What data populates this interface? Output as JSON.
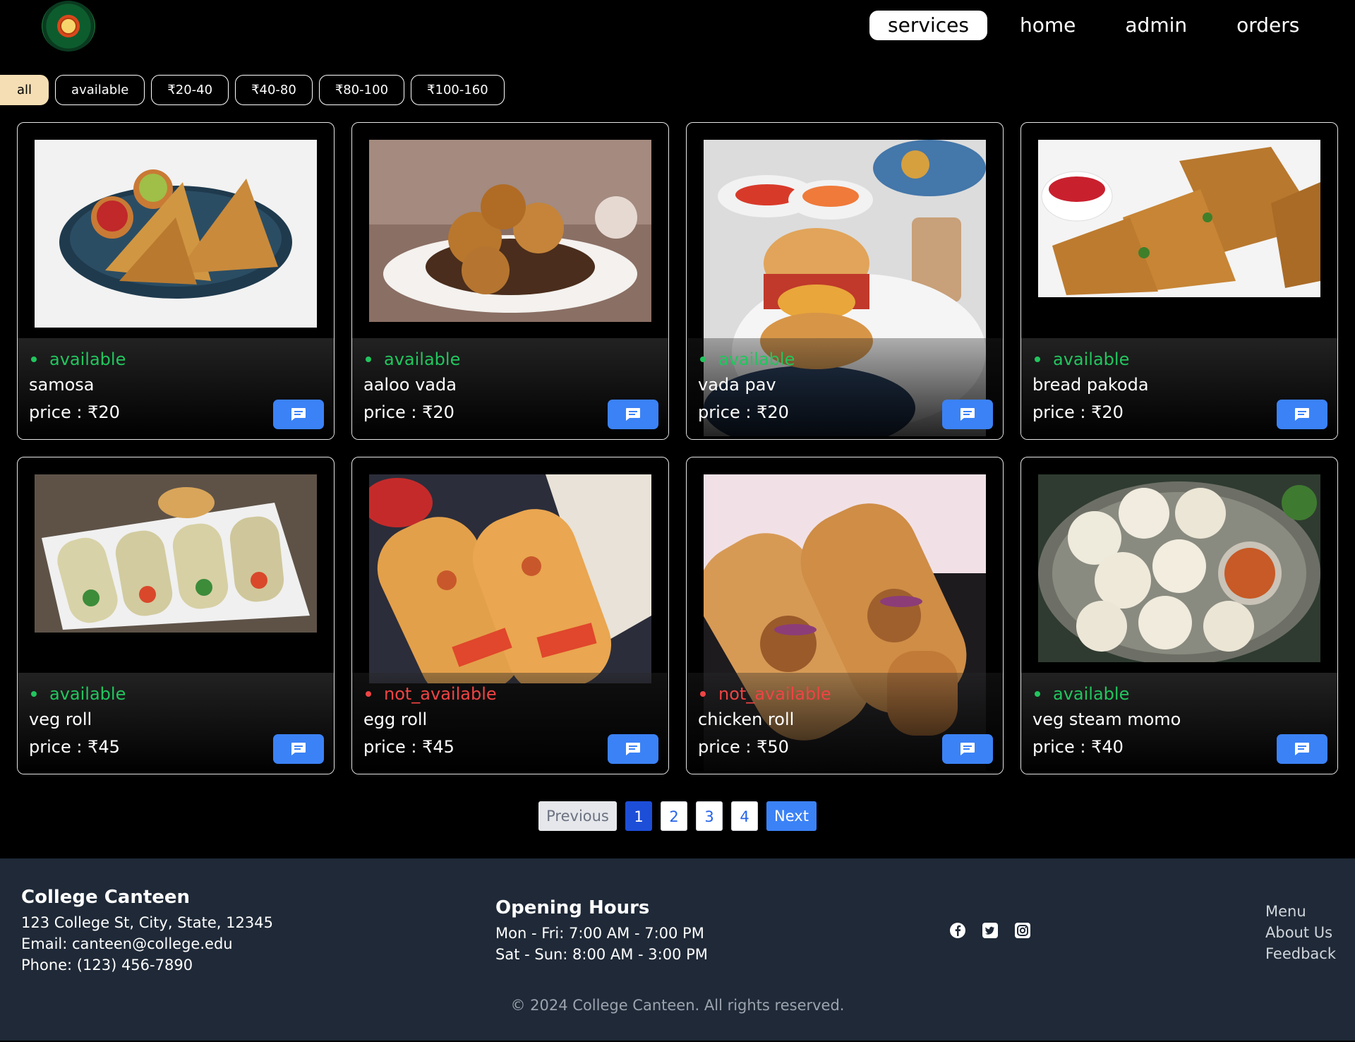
{
  "header": {
    "nav": [
      "services",
      "home",
      "admin",
      "orders"
    ],
    "active_nav": "services"
  },
  "filters": [
    "all",
    "available",
    "₹20-40",
    "₹40-80",
    "₹80-100",
    "₹100-160"
  ],
  "active_filter": "all",
  "colors": {
    "available": "#22c55e",
    "not_available": "#ef4444",
    "accent": "#3b82f6",
    "footer_bg": "#1f2937"
  },
  "items": [
    {
      "name": "samosa",
      "status": "available",
      "price": "price : ₹20"
    },
    {
      "name": "aaloo vada",
      "status": "available",
      "price": "price : ₹20"
    },
    {
      "name": "vada pav",
      "status": "available",
      "price": "price : ₹20"
    },
    {
      "name": "bread pakoda",
      "status": "available",
      "price": "price : ₹20"
    },
    {
      "name": "veg roll",
      "status": "available",
      "price": "price : ₹45"
    },
    {
      "name": "egg roll",
      "status": "not_available",
      "price": "price : ₹45"
    },
    {
      "name": "chicken roll",
      "status": "not_available",
      "price": "price : ₹50"
    },
    {
      "name": "veg steam momo",
      "status": "available",
      "price": "price : ₹40"
    }
  ],
  "pagination": {
    "prev": "Previous",
    "pages": [
      "1",
      "2",
      "3",
      "4"
    ],
    "current": "1",
    "next": "Next"
  },
  "footer": {
    "title": "College Canteen",
    "address": "123 College St, City, State, 12345",
    "email": "Email: canteen@college.edu",
    "phone": "Phone: (123) 456-7890",
    "hours_title": "Opening Hours",
    "hours_weekday": "Mon - Fri: 7:00 AM - 7:00 PM",
    "hours_weekend": "Sat - Sun: 8:00 AM - 3:00 PM",
    "social_icons": [
      "facebook-icon",
      "twitter-icon",
      "instagram-icon"
    ],
    "links": [
      "Menu",
      "About Us",
      "Feedback"
    ],
    "copyright": "© 2024 College Canteen. All rights reserved."
  }
}
